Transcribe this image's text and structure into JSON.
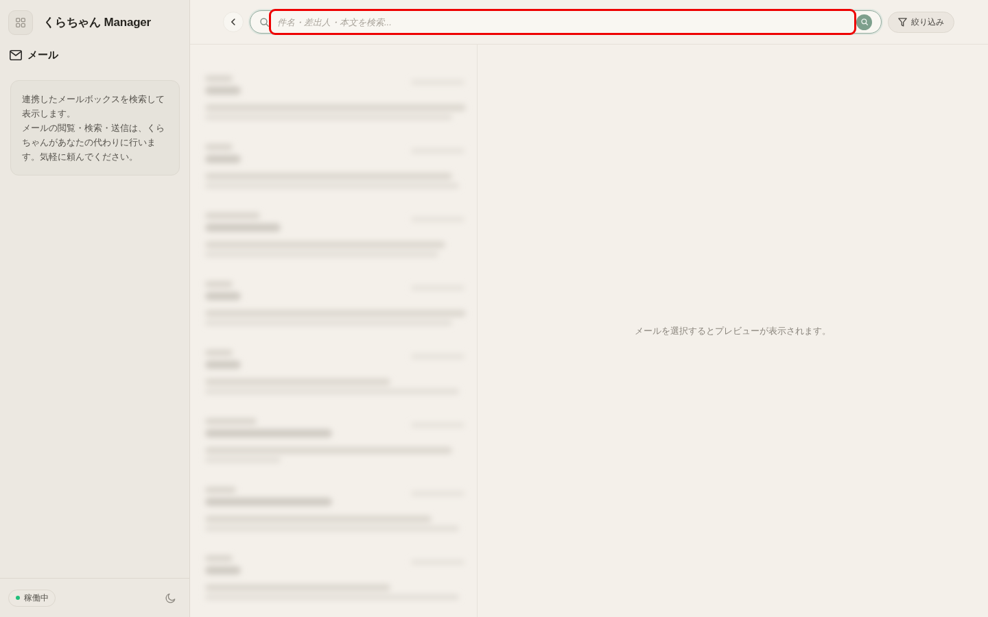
{
  "sidebar": {
    "app_title": "くらちゃん Manager",
    "section_title": "メール",
    "info_paragraphs": [
      "連携したメールボックスを検索して表示します。",
      "メールの閲覧・検索・送信は、くらちゃんがあなたの代わりに行います。気軽に頼んでください。"
    ],
    "status": {
      "label": "稼働中",
      "online": true
    }
  },
  "toolbar": {
    "search": {
      "placeholder": "件名・差出人・本文を検索...",
      "highlighted": true
    },
    "filter_button": "絞り込み"
  },
  "preview": {
    "empty_message": "メールを選択するとプレビューが表示されます。"
  }
}
